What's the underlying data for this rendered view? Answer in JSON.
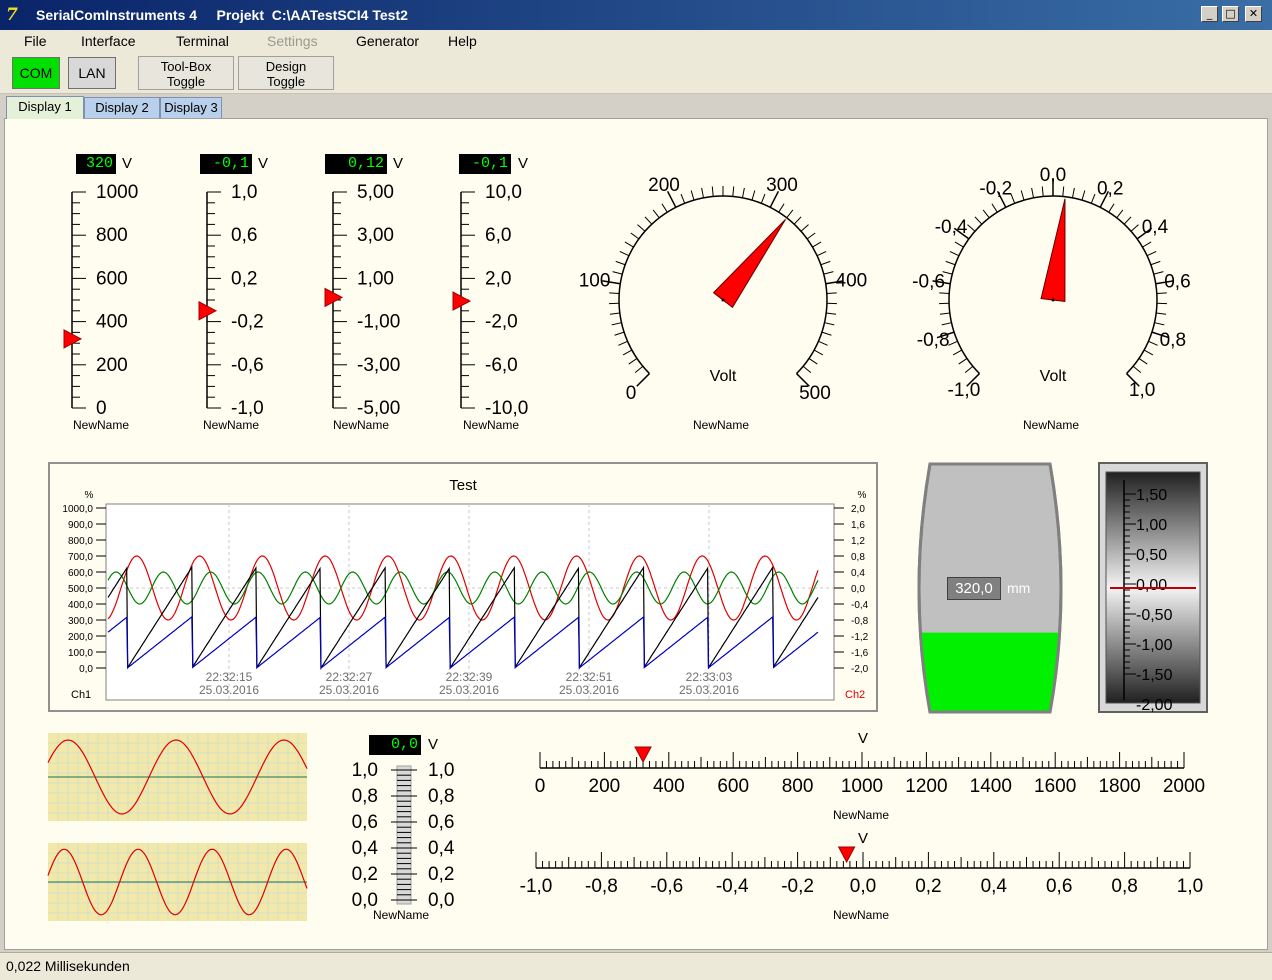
{
  "window": {
    "app_title": "SerialComInstruments 4",
    "project_title": "Projekt  C:\\AATestSCI4 Test2",
    "minimize": "_",
    "maximize": "□",
    "close": "✕"
  },
  "menu": [
    {
      "label": "File",
      "disabled": false
    },
    {
      "label": "Interface",
      "disabled": false
    },
    {
      "label": "Terminal",
      "disabled": false
    },
    {
      "label": "Settings",
      "disabled": true
    },
    {
      "label": "Generator",
      "disabled": false
    },
    {
      "label": "Help",
      "disabled": false
    }
  ],
  "toolbar": {
    "com": "COM",
    "lan": "LAN",
    "toolbox_line1": "Tool-Box",
    "toolbox_line2": "Toggle",
    "design_line1": "Design",
    "design_line2": "Toggle"
  },
  "tabs": [
    "Display 1",
    "Display 2",
    "Display 3"
  ],
  "bar_meters": [
    {
      "value_text": "320",
      "unit": "V",
      "name": "NewName",
      "labels": [
        "1000",
        "800",
        "600",
        "400",
        "200",
        "0"
      ],
      "min": 0,
      "max": 1000,
      "value": 320
    },
    {
      "value_text": "-0,1",
      "unit": "V",
      "name": "NewName",
      "labels": [
        "1,0",
        "0,6",
        "0,2",
        "-0,2",
        "-0,6",
        "-1,0"
      ],
      "min": -1,
      "max": 1,
      "value": -0.1
    },
    {
      "value_text": "0,12",
      "unit": "V",
      "name": "NewName",
      "labels": [
        "5,00",
        "3,00",
        "1,00",
        "-1,00",
        "-3,00",
        "-5,00"
      ],
      "min": -5,
      "max": 5,
      "value": 0.12
    },
    {
      "value_text": "-0,1",
      "unit": "V",
      "name": "NewName",
      "labels": [
        "10,0",
        "6,0",
        "2,0",
        "-2,0",
        "-6,0",
        "-10,0"
      ],
      "min": -10,
      "max": 10,
      "value": -0.1
    }
  ],
  "dials": [
    {
      "name": "NewName",
      "unit": "Volt",
      "labels": [
        "0",
        "100",
        "200",
        "300",
        "400",
        "500"
      ],
      "min": 0,
      "max": 500,
      "value": 320
    },
    {
      "name": "NewName",
      "unit": "Volt",
      "labels": [
        "-1,0",
        "-0,8",
        "-0,6",
        "-0,4",
        "-0,2",
        "0,0",
        "0,2",
        "0,4",
        "0,6",
        "0,8",
        "1,0"
      ],
      "min": -1,
      "max": 1,
      "value": 0.05
    }
  ],
  "chart_data": {
    "type": "line",
    "title": "Test",
    "left_axis_unit": "%",
    "right_axis_unit": "%",
    "left_ticks": [
      "1000,0",
      "900,0",
      "800,0",
      "700,0",
      "600,0",
      "500,0",
      "400,0",
      "300,0",
      "200,0",
      "100,0",
      "0,0"
    ],
    "right_ticks": [
      "2,0",
      "1,6",
      "1,2",
      "0,8",
      "0,4",
      "0,0",
      "-0,4",
      "-0,8",
      "-1,2",
      "-1,6",
      "-2,0"
    ],
    "ylim_left": [
      0,
      1000
    ],
    "ylim_right": [
      -2,
      2
    ],
    "x_time_labels": [
      "22:32:15",
      "22:32:27",
      "22:32:39",
      "22:32:51",
      "22:33:03"
    ],
    "x_date_labels": [
      "25.03.2016",
      "25.03.2016",
      "25.03.2016",
      "25.03.2016",
      "25.03.2016"
    ],
    "ch1_label": "Ch1",
    "ch2_label": "Ch2",
    "series": [
      {
        "color": "#e00000",
        "shape": "sine",
        "amplitude": 0.8,
        "offset": 0,
        "axis": "right",
        "cycles": 11.3
      },
      {
        "color": "#008000",
        "shape": "sine",
        "amplitude": 0.4,
        "offset": 0,
        "axis": "right",
        "cycles": 15
      },
      {
        "color": "#000000",
        "shape": "sawtooth",
        "min": 0,
        "max": 630,
        "axis": "left",
        "cycles": 11
      },
      {
        "color": "#0000c0",
        "shape": "sawtooth",
        "min": 0,
        "max": 320,
        "axis": "left",
        "cycles": 11
      }
    ],
    "grid": true
  },
  "tank": {
    "value_text": "320,0",
    "unit": "mm",
    "fill_fraction": 0.32
  },
  "vslider": {
    "labels": [
      "1,50",
      "1,00",
      "0,50",
      "0,00",
      "-0,50",
      "-1,00",
      "-1,50",
      "-2,00"
    ],
    "value": 0
  },
  "mini_recorders": [
    {
      "color": "#e00000",
      "cycles": 2.4
    },
    {
      "color": "#e00000",
      "cycles": 3.5
    }
  ],
  "small_meter": {
    "value_text": "0,0",
    "unit": "V",
    "name": "NewName",
    "labels": [
      "1,0",
      "0,8",
      "0,6",
      "0,4",
      "0,2",
      "0,0"
    ]
  },
  "h_scales": [
    {
      "unit": "V",
      "name": "NewName",
      "labels": [
        "0",
        "200",
        "400",
        "600",
        "800",
        "1000",
        "1200",
        "1400",
        "1600",
        "1800",
        "2000"
      ],
      "min": 0,
      "max": 2000,
      "value": 320
    },
    {
      "unit": "V",
      "name": "NewName",
      "labels": [
        "-1,0",
        "-0,8",
        "-0,6",
        "-0,4",
        "-0,2",
        "0,0",
        "0,2",
        "0,4",
        "0,6",
        "0,8",
        "1,0"
      ],
      "min": -1,
      "max": 1,
      "value": -0.05
    }
  ],
  "status": "0,022 Millisekunden"
}
